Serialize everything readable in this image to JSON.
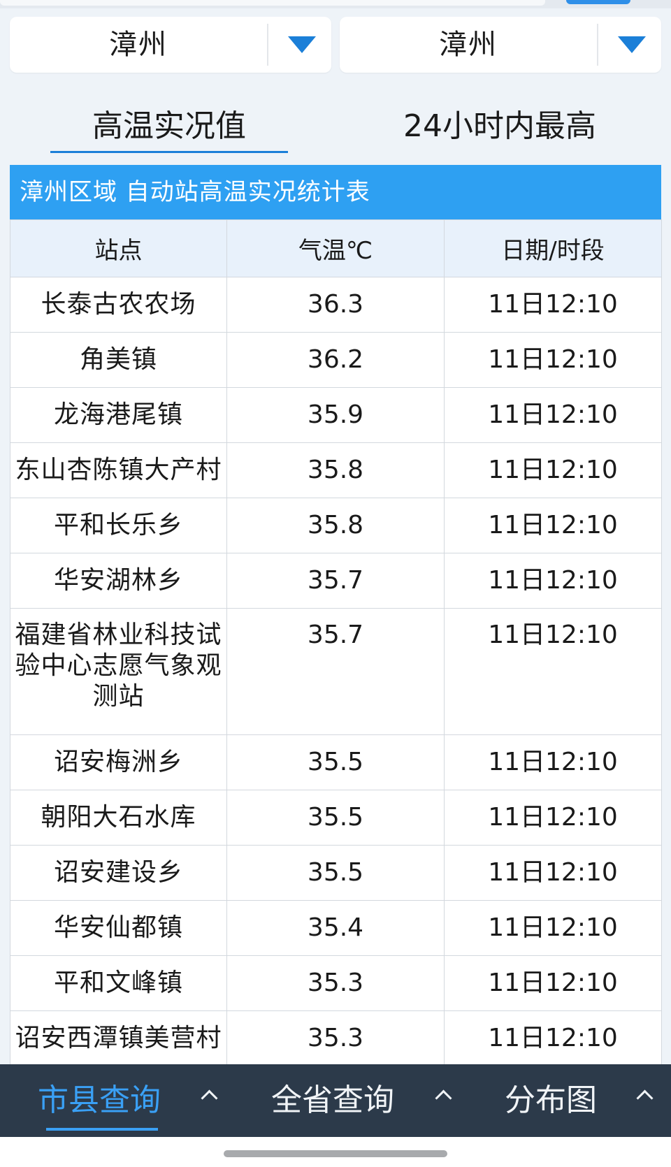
{
  "selectors": {
    "city": "漳州",
    "county": "漳州"
  },
  "tabs": [
    {
      "label": "高温实况值",
      "active": true
    },
    {
      "label": "24小时内最高",
      "active": false
    }
  ],
  "table": {
    "title": "漳州区域 自动站高温实况统计表",
    "headers": [
      "站点",
      "气温℃",
      "日期/时段"
    ],
    "rows": [
      {
        "station": "长泰古农农场",
        "temp": "36.3",
        "time": "11日12:10"
      },
      {
        "station": "角美镇",
        "temp": "36.2",
        "time": "11日12:10"
      },
      {
        "station": "龙海港尾镇",
        "temp": "35.9",
        "time": "11日12:10"
      },
      {
        "station": "东山杏陈镇大产村",
        "temp": "35.8",
        "time": "11日12:10"
      },
      {
        "station": "平和长乐乡",
        "temp": "35.8",
        "time": "11日12:10"
      },
      {
        "station": "华安湖林乡",
        "temp": "35.7",
        "time": "11日12:10"
      },
      {
        "station": "福建省林业科技试验中心志愿气象观测站",
        "temp": "35.7",
        "time": "11日12:10"
      },
      {
        "station": "诏安梅洲乡",
        "temp": "35.5",
        "time": "11日12:10"
      },
      {
        "station": "朝阳大石水库",
        "temp": "35.5",
        "time": "11日12:10"
      },
      {
        "station": "诏安建设乡",
        "temp": "35.5",
        "time": "11日12:10"
      },
      {
        "station": "华安仙都镇",
        "temp": "35.4",
        "time": "11日12:10"
      },
      {
        "station": "平和文峰镇",
        "temp": "35.3",
        "time": "11日12:10"
      },
      {
        "station": "诏安西潭镇美营村",
        "temp": "35.3",
        "time": "11日12:10"
      }
    ]
  },
  "bottom_nav": [
    {
      "label": "市县查询",
      "active": true
    },
    {
      "label": "全省查询",
      "active": false
    },
    {
      "label": "分布图",
      "active": false
    }
  ],
  "colors": {
    "accent": "#1b7fd8",
    "banner": "#2ea0f2",
    "nav_bg": "#2c3a4a",
    "nav_active": "#3aa0f5"
  },
  "icons": {
    "dropdown": "caret-down-icon",
    "nav_expand": "chevron-up-icon"
  }
}
